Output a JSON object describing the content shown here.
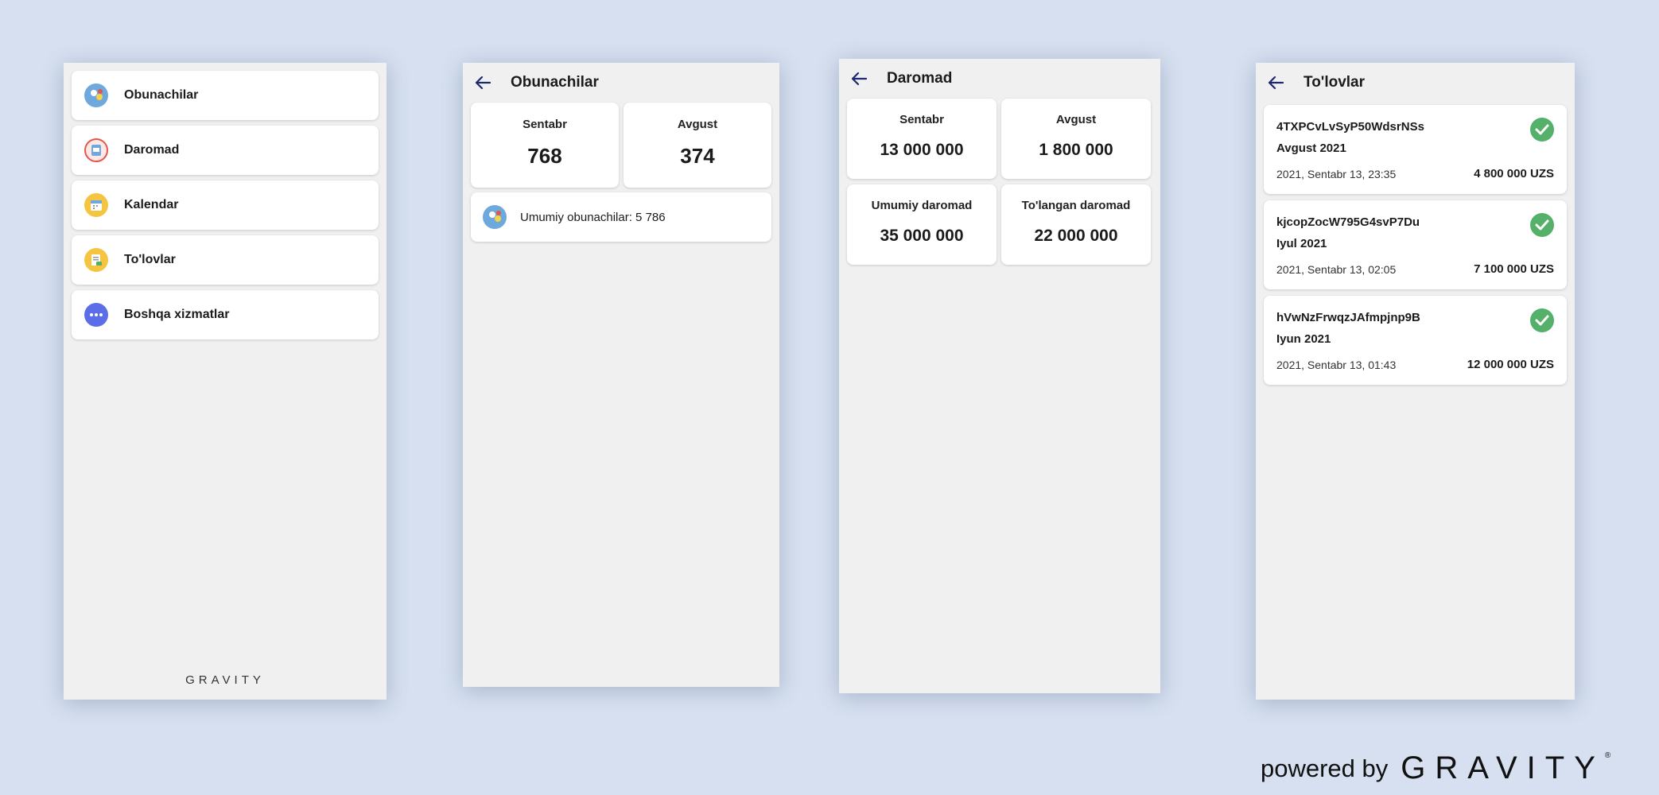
{
  "menu_screen": {
    "items": [
      {
        "label": "Obunachilar",
        "icon": "subscribers-icon",
        "color": "#6fa8dc"
      },
      {
        "label": "Daromad",
        "icon": "income-icon",
        "color": "#e2574c"
      },
      {
        "label": "Kalendar",
        "icon": "calendar-icon",
        "color": "#f5c542"
      },
      {
        "label": "To'lovlar",
        "icon": "payments-icon",
        "color": "#f5c542"
      },
      {
        "label": "Boshqa xizmatlar",
        "icon": "more-services-icon",
        "color": "#5b6ee8"
      }
    ],
    "brand": "GRAVITY"
  },
  "subscribers_screen": {
    "title": "Obunachilar",
    "stats": [
      {
        "label": "Sentabr",
        "value": "768"
      },
      {
        "label": "Avgust",
        "value": "374"
      }
    ],
    "total": "Umumiy obunachilar: 5 786"
  },
  "income_screen": {
    "title": "Daromad",
    "stats": [
      {
        "label": "Sentabr",
        "value": "13 000 000"
      },
      {
        "label": "Avgust",
        "value": "1 800 000"
      },
      {
        "label": "Umumiy daromad",
        "value": "35 000 000"
      },
      {
        "label": "To'langan daromad",
        "value": "22 000 000"
      }
    ]
  },
  "payments_screen": {
    "title": "To'lovlar",
    "items": [
      {
        "id": "4TXPCvLvSyP50WdsrNSs",
        "period": "Avgust 2021",
        "date": "2021, Sentabr 13, 23:35",
        "amount": "4 800 000 UZS",
        "status": "paid"
      },
      {
        "id": "kjcopZocW795G4svP7Du",
        "period": "Iyul 2021",
        "date": "2021, Sentabr 13, 02:05",
        "amount": "7 100 000 UZS",
        "status": "paid"
      },
      {
        "id": "hVwNzFrwqzJAfmpjnp9B",
        "period": "Iyun 2021",
        "date": "2021, Sentabr 13, 01:43",
        "amount": "12 000 000 UZS",
        "status": "paid"
      }
    ]
  },
  "footer": {
    "powered_by": "powered by",
    "brand": "GRAVITY",
    "trademark": "®"
  },
  "colors": {
    "background": "#d6e0f0",
    "screen": "#f0f0f0",
    "card": "#ffffff",
    "back_arrow": "#1e2a6e",
    "success": "#55b06a"
  }
}
